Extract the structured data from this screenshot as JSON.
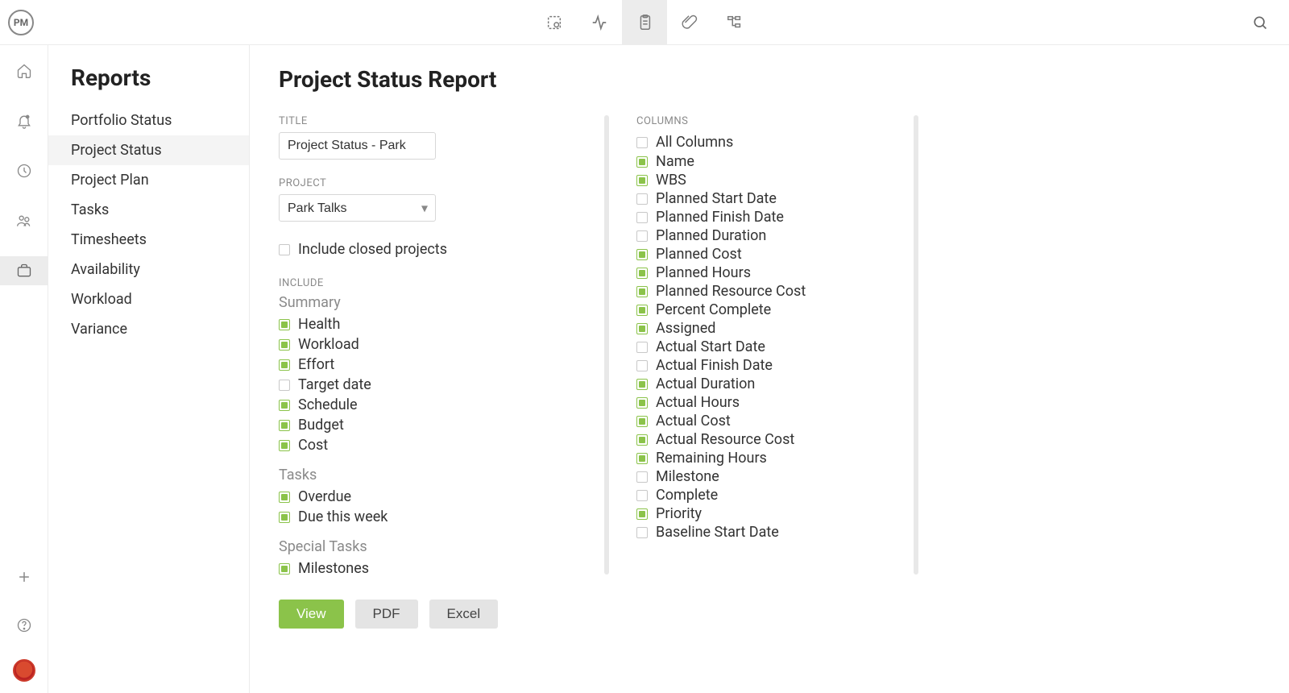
{
  "logo_text": "PM",
  "sidebar": {
    "title": "Reports",
    "items": [
      {
        "label": "Portfolio Status",
        "active": false
      },
      {
        "label": "Project Status",
        "active": true
      },
      {
        "label": "Project Plan",
        "active": false
      },
      {
        "label": "Tasks",
        "active": false
      },
      {
        "label": "Timesheets",
        "active": false
      },
      {
        "label": "Availability",
        "active": false
      },
      {
        "label": "Workload",
        "active": false
      },
      {
        "label": "Variance",
        "active": false
      }
    ]
  },
  "page": {
    "title": "Project Status Report",
    "title_field_label": "TITLE",
    "title_value": "Project Status - Park",
    "project_field_label": "PROJECT",
    "project_value": "Park Talks",
    "include_closed_label": "Include closed projects",
    "include_closed_checked": false,
    "include_label": "INCLUDE",
    "summary_heading": "Summary",
    "summary_items": [
      {
        "label": "Health",
        "checked": true
      },
      {
        "label": "Workload",
        "checked": true
      },
      {
        "label": "Effort",
        "checked": true
      },
      {
        "label": "Target date",
        "checked": false
      },
      {
        "label": "Schedule",
        "checked": true
      },
      {
        "label": "Budget",
        "checked": true
      },
      {
        "label": "Cost",
        "checked": true
      }
    ],
    "tasks_heading": "Tasks",
    "tasks_items": [
      {
        "label": "Overdue",
        "checked": true
      },
      {
        "label": "Due this week",
        "checked": true
      }
    ],
    "special_heading": "Special Tasks",
    "special_items": [
      {
        "label": "Milestones",
        "checked": true
      }
    ],
    "columns_label": "COLUMNS",
    "all_columns_label": "All Columns",
    "all_columns_checked": false,
    "columns": [
      {
        "label": "Name",
        "checked": true
      },
      {
        "label": "WBS",
        "checked": true
      },
      {
        "label": "Planned Start Date",
        "checked": false
      },
      {
        "label": "Planned Finish Date",
        "checked": false
      },
      {
        "label": "Planned Duration",
        "checked": false
      },
      {
        "label": "Planned Cost",
        "checked": true
      },
      {
        "label": "Planned Hours",
        "checked": true
      },
      {
        "label": "Planned Resource Cost",
        "checked": true
      },
      {
        "label": "Percent Complete",
        "checked": true
      },
      {
        "label": "Assigned",
        "checked": true
      },
      {
        "label": "Actual Start Date",
        "checked": false
      },
      {
        "label": "Actual Finish Date",
        "checked": false
      },
      {
        "label": "Actual Duration",
        "checked": true
      },
      {
        "label": "Actual Hours",
        "checked": true
      },
      {
        "label": "Actual Cost",
        "checked": true
      },
      {
        "label": "Actual Resource Cost",
        "checked": true
      },
      {
        "label": "Remaining Hours",
        "checked": true
      },
      {
        "label": "Milestone",
        "checked": false
      },
      {
        "label": "Complete",
        "checked": false
      },
      {
        "label": "Priority",
        "checked": true
      },
      {
        "label": "Baseline Start Date",
        "checked": false
      }
    ],
    "buttons": {
      "view": "View",
      "pdf": "PDF",
      "excel": "Excel"
    }
  }
}
